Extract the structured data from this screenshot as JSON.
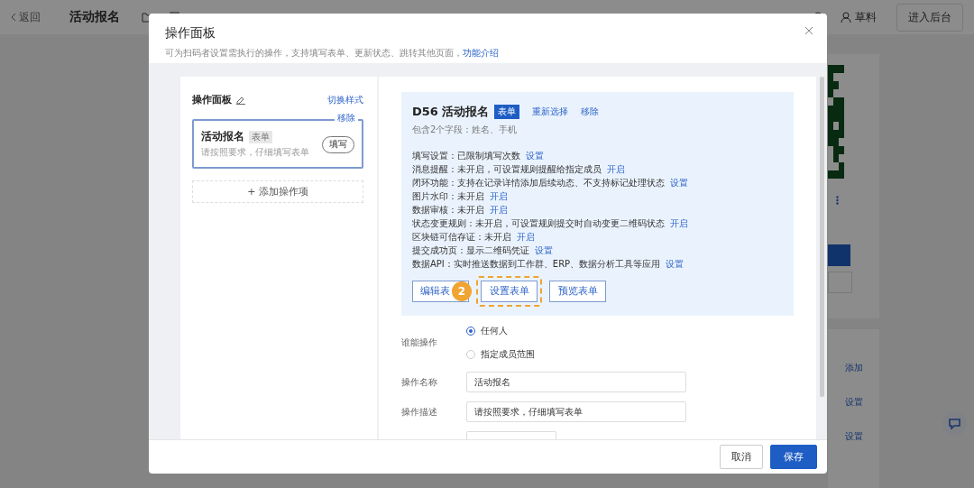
{
  "background_page": {
    "back": "返回",
    "title": "活动报名",
    "user": "草料",
    "admin_button": "进入后台",
    "side_links": [
      "添加",
      "设置",
      "设置"
    ]
  },
  "modal": {
    "title": "操作面板",
    "subtitle": "可为扫码者设置需执行的操作，支持填写表单、更新状态、跳转其他页面，",
    "subtitle_link": "功能介绍"
  },
  "left_panel": {
    "title": "操作面板",
    "switch_link": "切换样式",
    "items": [
      {
        "title": "活动报名",
        "tag": "表单",
        "description": "请按照要求，仔细填写表单",
        "action": "填写",
        "remove": "移除",
        "selected": true
      }
    ],
    "add_button": "+ 添加操作项"
  },
  "form_card": {
    "title": "D56 活动报名",
    "tag": "表单",
    "fields_info": "包含2个字段：姓名、手机",
    "links": [
      "重新选择",
      "移除"
    ],
    "settings": [
      {
        "text": "填写设置：已限制填写次数",
        "link": "设置"
      },
      {
        "text": "消息提醒：未开启，可设置规则提醒给指定成员",
        "link": "开启"
      },
      {
        "text": "闭环功能：支持在记录详情添加后续动态、不支持标记处理状态",
        "link": "设置"
      },
      {
        "text": "图片水印：未开启",
        "link": "开启"
      },
      {
        "text": "数据审核：未开启",
        "link": "开启"
      },
      {
        "text": "状态变更规则：未开启，可设置规则提交时自动变更二维码状态",
        "link": "开启"
      },
      {
        "text": "区块链可信存证：未开启",
        "link": "开启"
      },
      {
        "text": "提交成功页：显示二维码凭证",
        "link": "设置"
      },
      {
        "text": "数据API：实时推送数据到工作群、ERP、数据分析工具等应用",
        "link": "设置"
      }
    ],
    "buttons": [
      {
        "label": "编辑表",
        "highlighted": false
      },
      {
        "label": "设置表单",
        "highlighted": true
      },
      {
        "label": "预览表单",
        "highlighted": false
      }
    ],
    "step_badge": "2"
  },
  "who_can_operate": {
    "label": "谁能操作",
    "options": [
      {
        "label": "任何人",
        "selected": true
      },
      {
        "label": "指定成员范围",
        "selected": false
      }
    ]
  },
  "fields": [
    {
      "label": "操作名称",
      "value": "活动报名"
    },
    {
      "label": "操作描述",
      "value": "请按照要求，仔细填写表单"
    }
  ],
  "footer": {
    "cancel": "取消",
    "save": "保存"
  }
}
